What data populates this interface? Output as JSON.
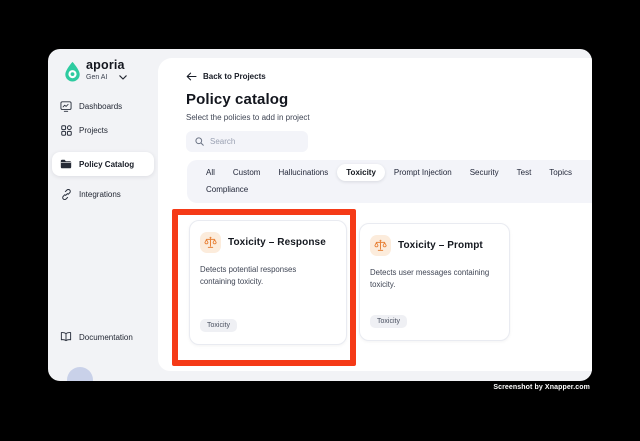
{
  "sidebar": {
    "brand": "aporia",
    "workspace": "Gen AI",
    "items": [
      {
        "label": "Dashboards",
        "icon": "dashboards-icon",
        "active": false
      },
      {
        "label": "Projects",
        "icon": "projects-icon",
        "active": false
      },
      {
        "label": "Policy Catalog",
        "icon": "folder-icon",
        "active": true
      },
      {
        "label": "Integrations",
        "icon": "link-icon",
        "active": false
      }
    ],
    "footer_label": "Documentation"
  },
  "main": {
    "back_link": "Back to Projects",
    "title": "Policy catalog",
    "subtitle": "Select the policies to add in project",
    "search": {
      "placeholder": "Search"
    },
    "tabs": {
      "row1": [
        "All",
        "Custom",
        "Hallucinations",
        "Toxicity",
        "Prompt Injection",
        "Security",
        "Test",
        "Topics"
      ],
      "row2": [
        "Compliance"
      ],
      "active": "Toxicity"
    },
    "cards": [
      {
        "title": "Toxicity – Response",
        "description": "Detects potential responses containing toxicity.",
        "tag": "Toxicity",
        "icon": "scales-icon",
        "highlighted": true
      },
      {
        "title": "Toxicity – Prompt",
        "description": "Detects user messages containing toxicity.",
        "tag": "Toxicity",
        "icon": "scales-icon",
        "highlighted": false
      }
    ]
  },
  "watermark": "Screenshot by Xnapper.com",
  "colors": {
    "brand_teal": "#2ecba0",
    "highlight_red": "#f53a17",
    "policy_icon_orange": "#e8833a",
    "policy_icon_bg": "#fcecdc",
    "window_bg": "#f2f3f6",
    "panel_bg": "#ffffff"
  }
}
